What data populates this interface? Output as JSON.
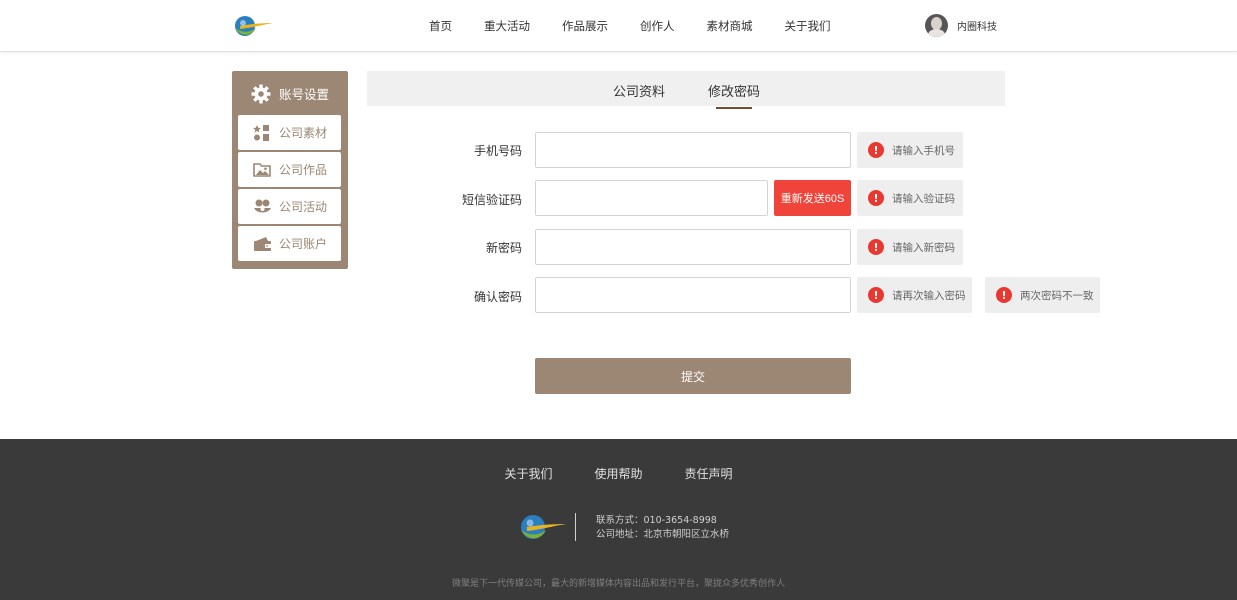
{
  "header": {
    "nav": [
      "首页",
      "重大活动",
      "作品展示",
      "创作人",
      "素材商城",
      "关于我们"
    ],
    "user_name": "内圈科技"
  },
  "sidebar": {
    "title": "账号设置",
    "items": [
      {
        "label": "公司素材",
        "icon": "shapes-icon"
      },
      {
        "label": "公司作品",
        "icon": "folder-image-icon"
      },
      {
        "label": "公司活动",
        "icon": "activity-icon"
      },
      {
        "label": "公司账户",
        "icon": "wallet-icon"
      }
    ]
  },
  "tabs": [
    {
      "label": "公司资料",
      "active": false
    },
    {
      "label": "修改密码",
      "active": true
    }
  ],
  "form": {
    "phone_label": "手机号码",
    "phone_value": "",
    "phone_error": "请输入手机号",
    "code_label": "短信验证码",
    "code_value": "",
    "resend_label": "重新发送60S",
    "code_error": "请输入验证码",
    "new_pwd_label": "新密码",
    "new_pwd_value": "",
    "new_pwd_error": "请输入新密码",
    "confirm_label": "确认密码",
    "confirm_value": "",
    "confirm_error": "请再次输入密码",
    "mismatch_error": "两次密码不一致",
    "error_icon_glyph": "!",
    "submit_label": "提交"
  },
  "footer": {
    "links": [
      "关于我们",
      "使用帮助",
      "责任声明"
    ],
    "contact_phone": "联系方式：010-3654-8998",
    "contact_address": "公司地址：北京市朝阳区立水桥",
    "slogan": "微聚是下一代传媒公司，最大的新增媒体内容出品和发行平台，聚拢众多优秀创作人"
  },
  "colors": {
    "brand": "#9b8773",
    "error": "#e8382f",
    "resend": "#f0433a",
    "footer_bg": "#3a3a3a",
    "tab_underline": "#7a4a2e"
  }
}
